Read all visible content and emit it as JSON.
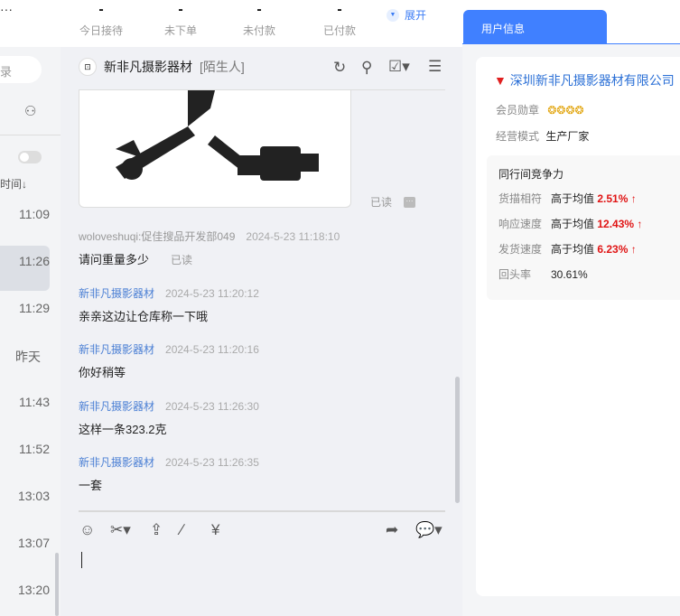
{
  "topbar": {
    "stats": [
      {
        "value": "-",
        "label": "今日接待"
      },
      {
        "value": "-",
        "label": "未下单"
      },
      {
        "value": "-",
        "label": "未付款"
      },
      {
        "value": "-",
        "label": "已付款"
      }
    ],
    "expand": "展开",
    "more": "···"
  },
  "left": {
    "search_partial": "录",
    "sort": "时间↓",
    "times": [
      "11:09",
      "11:26",
      "11:29",
      "昨天",
      "11:43",
      "11:52",
      "13:03",
      "13:07",
      "13:20"
    ]
  },
  "chat": {
    "title": "新非凡摄影器材",
    "tag": "[陌生人]",
    "read": "已读",
    "messages": [
      {
        "sender": "woloveshuqi:促佳搜品开发部049",
        "time": "2024-5-23 11:18:10",
        "text": "请问重量多少",
        "status": "已读"
      },
      {
        "sender": "新非凡摄影器材",
        "time": "2024-5-23 11:20:12",
        "text": "亲亲这边让仓库称一下哦"
      },
      {
        "sender": "新非凡摄影器材",
        "time": "2024-5-23 11:20:16",
        "text": "你好稍等"
      },
      {
        "sender": "新非凡摄影器材",
        "time": "2024-5-23 11:26:30",
        "text": "这样一条323.2克"
      },
      {
        "sender": "新非凡摄影器材",
        "time": "2024-5-23 11:26:35",
        "text": "一套"
      }
    ]
  },
  "right": {
    "tab": "用户信息",
    "company": "深圳新非凡摄影器材有限公司",
    "badge_label": "会员勋章",
    "mode_label": "经营模式",
    "mode": "生产厂家",
    "compete": {
      "title": "同行间竞争力",
      "rows": [
        {
          "label": "货描相符",
          "prefix": "高于均值",
          "value": "2.51%",
          "arrow": "↑"
        },
        {
          "label": "响应速度",
          "prefix": "高于均值",
          "value": "12.43%",
          "arrow": "↑"
        },
        {
          "label": "发货速度",
          "prefix": "高于均值",
          "value": "6.23%",
          "arrow": "↑"
        }
      ],
      "repeat_label": "回头率",
      "repeat": "30.61%"
    }
  },
  "colors": {
    "accent": "#4080ff",
    "red": "#e01414"
  }
}
